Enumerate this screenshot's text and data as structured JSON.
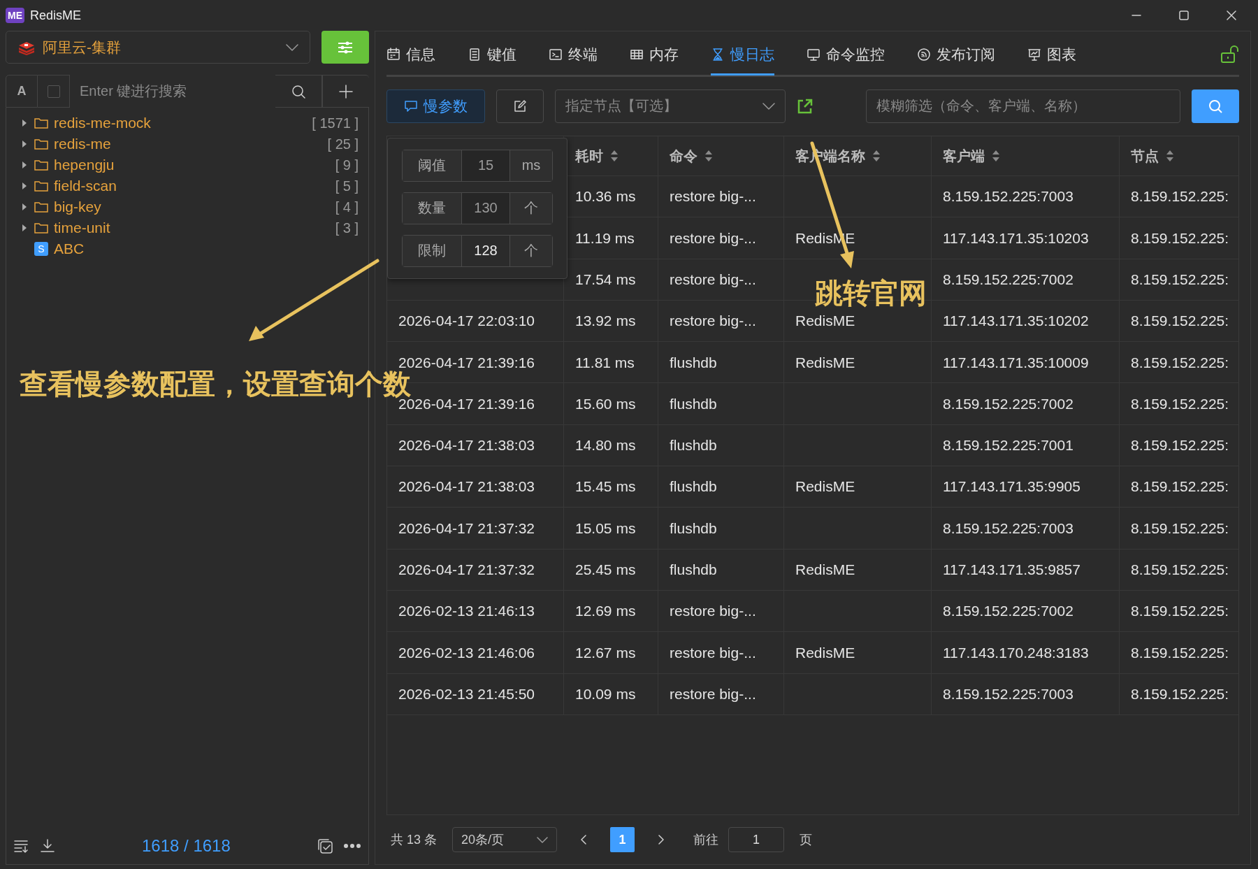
{
  "window": {
    "title": "RedisME",
    "logo": "ME"
  },
  "connection": {
    "name": "阿里云-集群"
  },
  "key_search": {
    "mode": "A",
    "checked": false,
    "placeholder": "Enter 键进行搜索"
  },
  "tree": [
    {
      "kind": "folder",
      "name": "redis-me-mock",
      "count": "[ 1571 ]",
      "expanded": false
    },
    {
      "kind": "folder",
      "name": "redis-me",
      "count": "[ 25 ]",
      "expanded": false
    },
    {
      "kind": "folder",
      "name": "hepengju",
      "count": "[ 9 ]",
      "expanded": false
    },
    {
      "kind": "folder",
      "name": "field-scan",
      "count": "[ 5 ]",
      "expanded": false
    },
    {
      "kind": "folder",
      "name": "big-key",
      "count": "[ 4 ]",
      "expanded": false
    },
    {
      "kind": "folder",
      "name": "time-unit",
      "count": "[ 3 ]",
      "expanded": false
    },
    {
      "kind": "key",
      "name": "ABC",
      "badge": "S"
    }
  ],
  "key_count": "1618 / 1618",
  "tabs": [
    {
      "label": "信息",
      "selected": false
    },
    {
      "label": "键值",
      "selected": false
    },
    {
      "label": "终端",
      "selected": false
    },
    {
      "label": "内存",
      "selected": false
    },
    {
      "label": "慢日志",
      "selected": true
    },
    {
      "label": "命令监控",
      "selected": false
    },
    {
      "label": "发布订阅",
      "selected": false
    },
    {
      "label": "图表",
      "selected": false
    }
  ],
  "toolbar": {
    "slow_params": "慢参数",
    "node_select": {
      "placeholder": "指定节点【可选】"
    },
    "filter": {
      "placeholder": "模糊筛选（命令、客户端、名称）"
    }
  },
  "popover": {
    "rows": [
      {
        "label": "阈值",
        "value": "15",
        "unit": "ms",
        "disabled": true
      },
      {
        "label": "数量",
        "value": "130",
        "unit": "个",
        "disabled": true
      },
      {
        "label": "限制",
        "value": "128",
        "unit": "个",
        "disabled": false
      }
    ]
  },
  "table": {
    "columns": [
      {
        "label": "耗时"
      },
      {
        "label": "命令"
      },
      {
        "label": "客户端名称"
      },
      {
        "label": "客户端"
      },
      {
        "label": "节点"
      }
    ],
    "rows": [
      {
        "duration": "10.36 ms",
        "command": "restore big-...",
        "client": "8.159.152.225:7003",
        "node": "8.159.152.225:"
      },
      {
        "duration": "11.19 ms",
        "command": "restore big-...",
        "client_name": "RedisME",
        "client": "117.143.171.35:10203",
        "node": "8.159.152.225:"
      },
      {
        "duration": "17.54 ms",
        "command": "restore big-...",
        "client": "8.159.152.225:7002",
        "node": "8.159.152.225:"
      },
      {
        "time": "2026-04-17 22:03:10",
        "duration": "13.92 ms",
        "command": "restore big-...",
        "client_name": "RedisME",
        "client": "117.143.171.35:10202",
        "node": "8.159.152.225:"
      },
      {
        "time": "2026-04-17 21:39:16",
        "duration": "11.81 ms",
        "command": "flushdb",
        "client_name": "RedisME",
        "client": "117.143.171.35:10009",
        "node": "8.159.152.225:"
      },
      {
        "time": "2026-04-17 21:39:16",
        "duration": "15.60 ms",
        "command": "flushdb",
        "client": "8.159.152.225:7002",
        "node": "8.159.152.225:"
      },
      {
        "time": "2026-04-17 21:38:03",
        "duration": "14.80 ms",
        "command": "flushdb",
        "client": "8.159.152.225:7001",
        "node": "8.159.152.225:"
      },
      {
        "time": "2026-04-17 21:38:03",
        "duration": "15.45 ms",
        "command": "flushdb",
        "client_name": "RedisME",
        "client": "117.143.171.35:9905",
        "node": "8.159.152.225:"
      },
      {
        "time": "2026-04-17 21:37:32",
        "duration": "15.05 ms",
        "command": "flushdb",
        "client": "8.159.152.225:7003",
        "node": "8.159.152.225:"
      },
      {
        "time": "2026-04-17 21:37:32",
        "duration": "25.45 ms",
        "command": "flushdb",
        "client_name": "RedisME",
        "client": "117.143.171.35:9857",
        "node": "8.159.152.225:"
      },
      {
        "time": "2026-02-13 21:46:13",
        "duration": "12.69 ms",
        "command": "restore big-...",
        "client": "8.159.152.225:7002",
        "node": "8.159.152.225:"
      },
      {
        "time": "2026-02-13 21:46:06",
        "duration": "12.67 ms",
        "command": "restore big-...",
        "client_name": "RedisME",
        "client": "117.143.170.248:3183",
        "node": "8.159.152.225:"
      },
      {
        "time": "2026-02-13 21:45:50",
        "duration": "10.09 ms",
        "command": "restore big-...",
        "client": "8.159.152.225:7003",
        "node": "8.159.152.225:"
      }
    ]
  },
  "pagination": {
    "total": "共 13 条",
    "page_size": "20条/页",
    "pages": [
      {
        "label": "1",
        "selected": true
      }
    ],
    "goto_label": "前往",
    "goto_value": "1",
    "page_suffix": "页"
  },
  "annotations": [
    {
      "text": "查看慢参数配置，设置查询个数"
    },
    {
      "text": "跳转官网"
    }
  ]
}
